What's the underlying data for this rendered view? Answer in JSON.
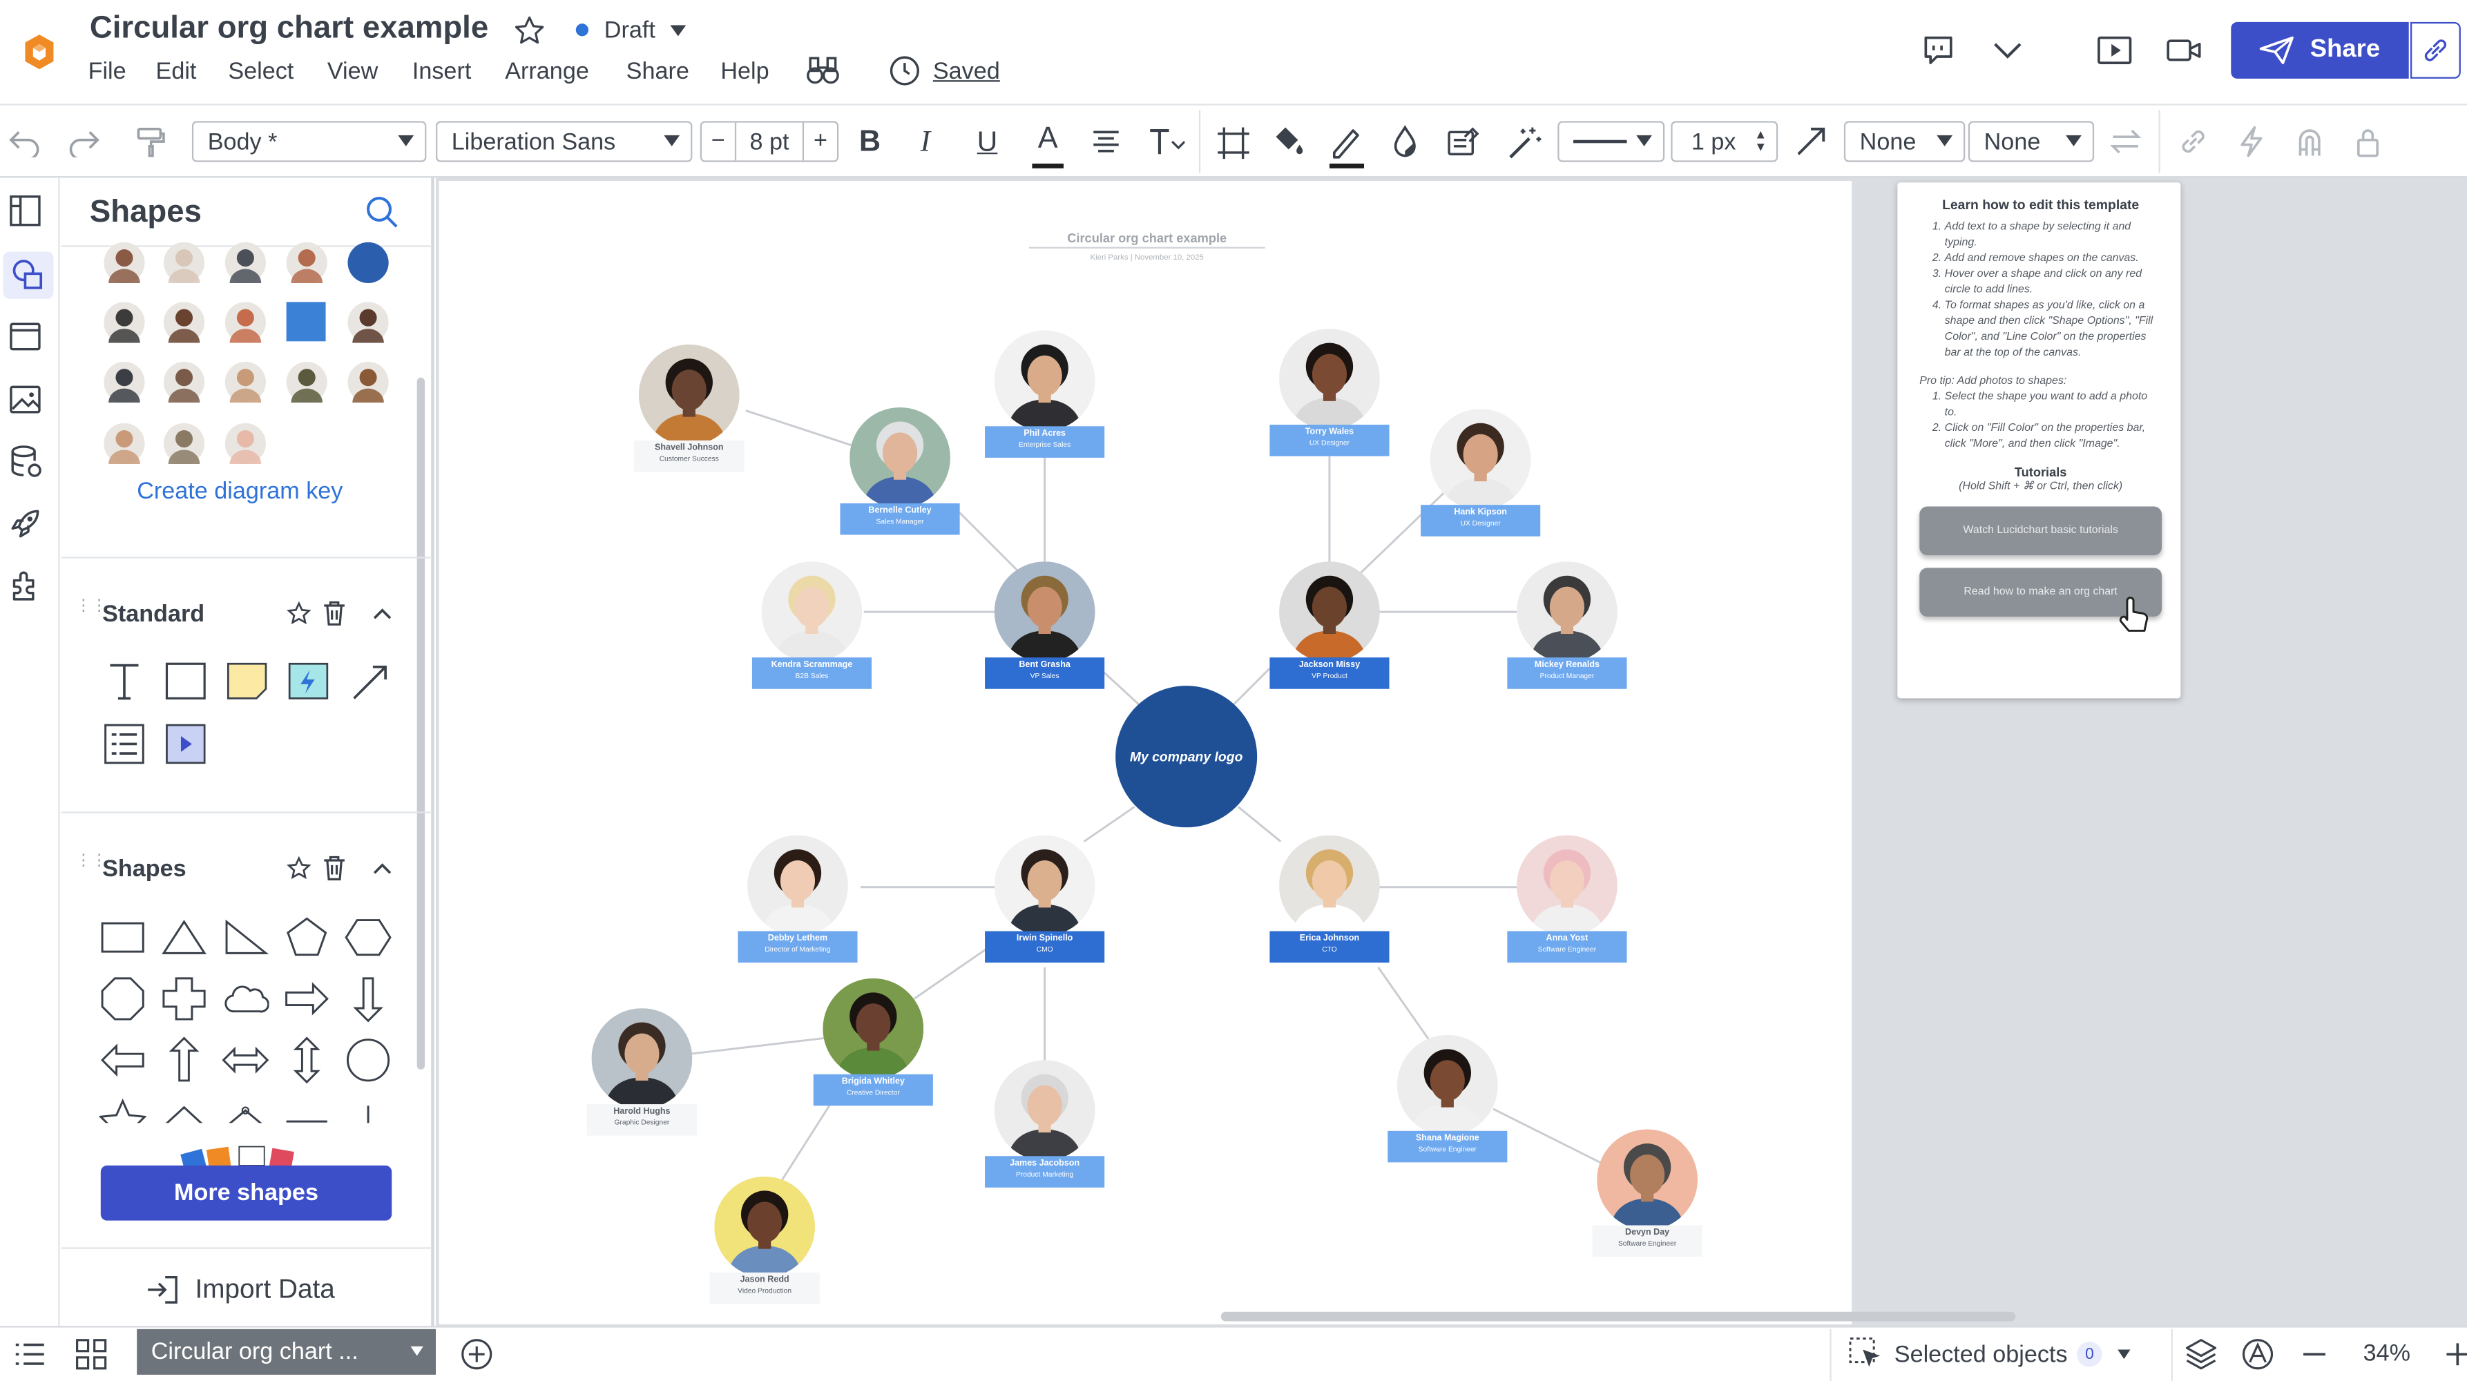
{
  "app": {
    "doc_title": "Circular org chart example",
    "status": "Draft",
    "saved": "Saved",
    "share": "Share"
  },
  "menu": [
    "File",
    "Edit",
    "Select",
    "View",
    "Insert",
    "Arrange",
    "Share",
    "Help"
  ],
  "toolbar": {
    "style": "Body *",
    "font": "Liberation Sans",
    "font_size": "8 pt",
    "line_width": "1 px",
    "arrow_start": "None",
    "arrow_end": "None",
    "bold": "B",
    "italic": "I",
    "underline": "U",
    "text_color": "A"
  },
  "shapes_panel": {
    "title": "Shapes",
    "diagram_key": "Create diagram key",
    "section_standard": "Standard",
    "section_shapes": "Shapes",
    "more_shapes": "More shapes",
    "import_data": "Import Data"
  },
  "canvas": {
    "chart_title": "Circular org chart example",
    "chart_subtitle": "Kieri Parks | November 10, 2025",
    "logo_text": "My company logo"
  },
  "people": [
    {
      "name": "Shavell Johnson",
      "role": "Customer Success"
    },
    {
      "name": "Bernelle Cutley",
      "role": "Sales Manager"
    },
    {
      "name": "Phil Acres",
      "role": "Enterprise Sales"
    },
    {
      "name": "Torry Wales",
      "role": "UX Designer"
    },
    {
      "name": "Hank Kipson",
      "role": "UX Designer"
    },
    {
      "name": "Kendra Scrammage",
      "role": "B2B Sales"
    },
    {
      "name": "Bent Grasha",
      "role": "VP Sales"
    },
    {
      "name": "Jackson Missy",
      "role": "VP Product"
    },
    {
      "name": "Mickey Renalds",
      "role": "Product Manager"
    },
    {
      "name": "Debby Lethem",
      "role": "Director of Marketing"
    },
    {
      "name": "Irwin Spinello",
      "role": "CMO"
    },
    {
      "name": "Erica Johnson",
      "role": "CTO"
    },
    {
      "name": "Anna Yost",
      "role": "Software Engineer"
    },
    {
      "name": "Harold Hughs",
      "role": "Graphic Designer"
    },
    {
      "name": "Brigida Whitley",
      "role": "Creative Director"
    },
    {
      "name": "James Jacobson",
      "role": "Product Marketing"
    },
    {
      "name": "Shana Magione",
      "role": "Software Engineer"
    },
    {
      "name": "Jason Redd",
      "role": "Video Production"
    },
    {
      "name": "Devyn Day",
      "role": "Software Engineer"
    }
  ],
  "help_card": {
    "title": "Learn how to edit this template",
    "steps": [
      "Add text to a shape by selecting it and typing.",
      "Add and remove shapes on the canvas.",
      "Hover over a shape and click on any red circle to add lines.",
      "To format shapes as you'd like, click on a shape and then click \"Shape Options\", \"Fill Color\", and \"Line Color\" on the properties bar at the top of the canvas."
    ],
    "protip": "Pro tip: Add photos to shapes:",
    "protip_steps": [
      "Select the shape you want to add a photo to.",
      "Click on \"Fill Color\" on the properties bar, click \"More\", and then click \"Image\"."
    ],
    "tutorials": "Tutorials",
    "tutorials_hint": "(Hold Shift + ⌘ or Ctrl, then click)",
    "btn1": "Watch Lucidchart basic tutorials",
    "btn2": "Read how to make an org chart"
  },
  "statusbar": {
    "page_tab": "Circular org chart ...",
    "selected": "Selected objects",
    "selected_count": "0",
    "zoom": "34%"
  },
  "colors": {
    "accent": "#3d4fc8",
    "node_dark": "#2e6dd1",
    "node_light": "#6ea8ee",
    "logo": "#1f5096"
  }
}
